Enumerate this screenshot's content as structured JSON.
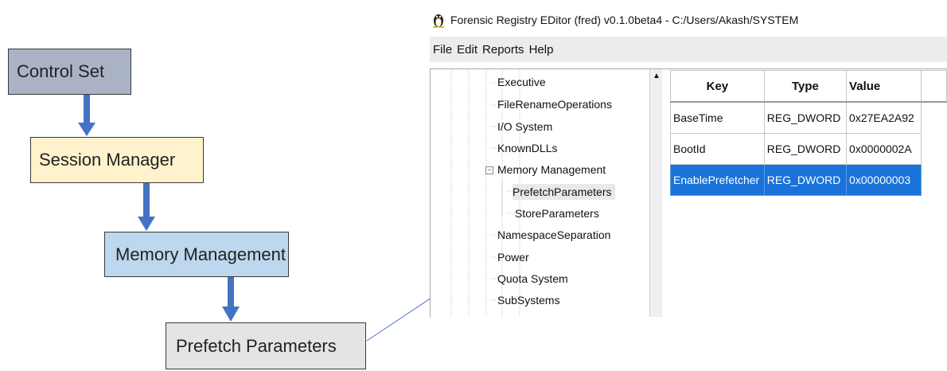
{
  "diagram": {
    "boxes": [
      {
        "label": "Control Set",
        "color": "#aab3c6"
      },
      {
        "label": "Session Manager",
        "color": "#fff2cc"
      },
      {
        "label": "Memory Management",
        "color": "#bdd7ee"
      },
      {
        "label": "Prefetch Parameters",
        "color": "#e4e4e4"
      }
    ],
    "arrow_color": "#4472c4"
  },
  "window": {
    "icon": "linux-tux-icon",
    "title": "Forensic Registry EDitor (fred) v0.1.0beta4 - C:/Users/Akash/SYSTEM"
  },
  "menu": [
    "File",
    "Edit",
    "Reports",
    "Help"
  ],
  "tree": {
    "items": [
      {
        "label": "Executive"
      },
      {
        "label": "FileRenameOperations"
      },
      {
        "label": "I/O System"
      },
      {
        "label": "KnownDLLs"
      },
      {
        "label": "Memory Management",
        "expanded": true
      },
      {
        "label": "PrefetchParameters",
        "selected": true
      },
      {
        "label": "StoreParameters"
      },
      {
        "label": "NamespaceSeparation"
      },
      {
        "label": "Power"
      },
      {
        "label": "Quota System"
      },
      {
        "label": "SubSystems"
      }
    ]
  },
  "table": {
    "headers": [
      "Key",
      "Type",
      "Value"
    ],
    "rows": [
      {
        "key": "BaseTime",
        "type": "REG_DWORD",
        "value": "0x27EA2A92"
      },
      {
        "key": "BootId",
        "type": "REG_DWORD",
        "value": "0x0000002A"
      },
      {
        "key": "EnablePrefetcher",
        "type": "REG_DWORD",
        "value": "0x00000003",
        "selected": true
      }
    ],
    "selected_row_color": "#1a73d9"
  }
}
